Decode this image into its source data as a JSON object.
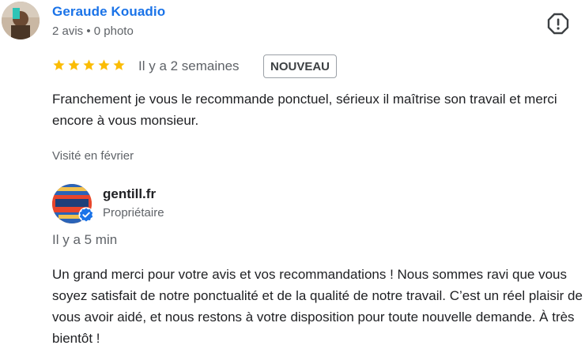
{
  "review": {
    "reviewer_name": "Geraude Kouadio",
    "reviewer_stats": "2 avis • 0 photo",
    "rating": 5,
    "rating_max": 5,
    "date": "Il y a 2 semaines",
    "badge": "NOUVEAU",
    "text": "Franchement je vous le recommande ponctuel, sérieux il maîtrise son travail et merci encore à vous monsieur.",
    "visited": "Visité en février",
    "flag_icon": "report-flag-icon"
  },
  "owner_reply": {
    "name": "gentill.fr",
    "role": "Propriétaire",
    "date": "Il y a 5 min",
    "text": "Un grand merci pour votre avis et vos recommandations ! Nous sommes ravi que vous soyez satisfait de notre ponctualité et de la qualité de notre travail. C’est un réel plaisir de vous avoir aidé, et nous restons à votre disposition pour toute nouvelle demande. À très bientôt !",
    "verified_icon": "verified-badge-icon"
  },
  "colors": {
    "link": "#1a73e8",
    "star": "#fbbc04",
    "secondary_text": "#5f6368",
    "verified": "#1a73e8"
  }
}
